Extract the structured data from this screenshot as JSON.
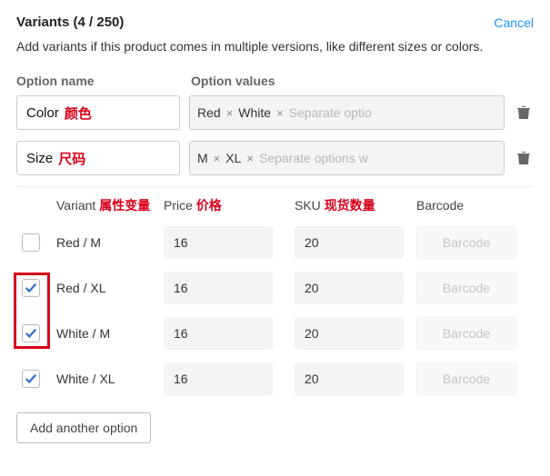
{
  "header": {
    "title": "Variants (4 / 250)",
    "cancel": "Cancel"
  },
  "description": "Add variants if this product comes in multiple versions, like different sizes or colors.",
  "labels": {
    "option_name": "Option name",
    "option_values": "Option values"
  },
  "options": [
    {
      "name": "Color",
      "annotation": "颜色",
      "values": [
        "Red",
        "White"
      ],
      "placeholder": "Separate optio"
    },
    {
      "name": "Size",
      "annotation": "尺码",
      "values": [
        "M",
        "XL"
      ],
      "placeholder": "Separate options w"
    }
  ],
  "table": {
    "headers": {
      "variant": "Variant",
      "variant_ann": "属性变量",
      "price": "Price",
      "price_ann": "价格",
      "sku": "SKU",
      "sku_ann": "现货数量",
      "barcode": "Barcode"
    },
    "rows": [
      {
        "checked": false,
        "variant": "Red / M",
        "price": "16",
        "sku": "20",
        "barcode": "Barcode"
      },
      {
        "checked": true,
        "variant": "Red / XL",
        "price": "16",
        "sku": "20",
        "barcode": "Barcode"
      },
      {
        "checked": true,
        "variant": "White / M",
        "price": "16",
        "sku": "20",
        "barcode": "Barcode"
      },
      {
        "checked": true,
        "variant": "White / XL",
        "price": "16",
        "sku": "20",
        "barcode": "Barcode"
      }
    ]
  },
  "add_button": "Add another option"
}
